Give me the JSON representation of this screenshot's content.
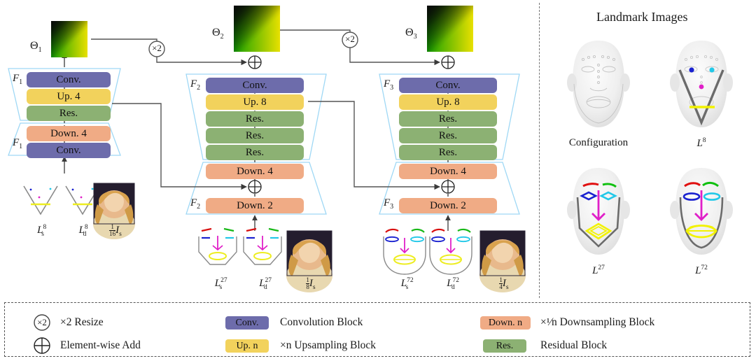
{
  "figure": {
    "panel_title": "Landmark Images"
  },
  "stages": [
    {
      "id": "stage1",
      "theta_label": "Θ1",
      "ftag_top": "F1",
      "ftag_bottom": "F1",
      "blocks_top": [
        "Conv.",
        "Up. 4",
        "Res."
      ],
      "blocks_bottom": [
        "Down. 4",
        "Conv."
      ],
      "inputs": [
        "L8s",
        "L8d",
        "1/16 Is"
      ],
      "input_captions": [
        "L",
        "L",
        "I"
      ],
      "resize_label": "×2"
    },
    {
      "id": "stage2",
      "theta_label": "Θ2",
      "ftag_top": "F2",
      "ftag_bottom": "F2",
      "blocks_top": [
        "Conv.",
        "Up. 8",
        "Res.",
        "Res.",
        "Res."
      ],
      "blocks_bottom": [
        "Down. 4",
        "Down. 2"
      ],
      "inputs": [
        "L27s",
        "L27d",
        "1/8 Is"
      ],
      "resize_label": "×2"
    },
    {
      "id": "stage3",
      "theta_label": "Θ3",
      "ftag_top": "F3",
      "ftag_bottom": "F3",
      "blocks_top": [
        "Conv.",
        "Up. 8",
        "Res.",
        "Res.",
        "Res."
      ],
      "blocks_bottom": [
        "Down. 4",
        "Down. 2"
      ],
      "inputs": [
        "L72s",
        "L72d",
        "1/4 Is"
      ]
    }
  ],
  "stage_labels": {
    "s1": {
      "theta": "Θ",
      "theta_sub": "1",
      "f_top": "F",
      "f_top_sub": "1",
      "f_bot": "F",
      "f_bot_sub": "1",
      "b0": "Conv.",
      "b1": "Up. 4",
      "b2": "Res.",
      "b3": "Down. 4",
      "b4": "Conv.",
      "cap_ls": "L",
      "cap_ls_sup": "8",
      "cap_ls_sub": "s",
      "cap_ld": "L",
      "cap_ld_sup": "8",
      "cap_ld_sub": "d",
      "cap_img_num": "1",
      "cap_img_den": "16",
      "cap_img": "I",
      "cap_img_sub": "s"
    },
    "s2": {
      "theta": "Θ",
      "theta_sub": "2",
      "f_top": "F",
      "f_top_sub": "2",
      "f_bot": "F",
      "f_bot_sub": "2",
      "b0": "Conv.",
      "b1": "Up. 8",
      "b2": "Res.",
      "b3": "Res.",
      "b4": "Res.",
      "b5": "Down. 4",
      "b6": "Down. 2",
      "cap_ls": "L",
      "cap_ls_sup": "27",
      "cap_ls_sub": "s",
      "cap_ld": "L",
      "cap_ld_sup": "27",
      "cap_ld_sub": "d",
      "cap_img_num": "1",
      "cap_img_den": "8",
      "cap_img": "I",
      "cap_img_sub": "s"
    },
    "s3": {
      "theta": "Θ",
      "theta_sub": "3",
      "f_top": "F",
      "f_top_sub": "3",
      "f_bot": "F",
      "f_bot_sub": "3",
      "b0": "Conv.",
      "b1": "Up. 8",
      "b2": "Res.",
      "b3": "Res.",
      "b4": "Res.",
      "b5": "Down. 4",
      "b6": "Down. 2",
      "cap_ls": "L",
      "cap_ls_sup": "72",
      "cap_ls_sub": "s",
      "cap_ld": "L",
      "cap_ld_sup": "72",
      "cap_ld_sub": "d",
      "cap_img_num": "1",
      "cap_img_den": "4",
      "cap_img": "I",
      "cap_img_sub": "s"
    }
  },
  "resize_nodes": {
    "r1": "×2",
    "r2": "×2"
  },
  "landmark_panel": {
    "title": "Landmark Images",
    "items": [
      {
        "label": "Configuration",
        "sup": ""
      },
      {
        "label": "L",
        "sup": "8"
      },
      {
        "label": "L",
        "sup": "27"
      },
      {
        "label": "L",
        "sup": "72"
      }
    ]
  },
  "legend": {
    "rows": [
      {
        "icon": "×2",
        "icon_kind": "circle-x2",
        "text": "×2 Resize"
      },
      {
        "icon": "⊕",
        "icon_kind": "circle-plus",
        "text": "Element-wise Add"
      }
    ],
    "chips": [
      {
        "chip": "Conv.",
        "kind": "conv",
        "text": "Convolution Block"
      },
      {
        "chip": "Up. n",
        "kind": "up",
        "text_pre": "×n Upsampling Block",
        "text": "×n Upsampling Block"
      },
      {
        "chip": "Down. n",
        "kind": "down",
        "text": "×¹⁄n Downsampling Block"
      },
      {
        "chip": "Res.",
        "kind": "res",
        "text": "Residual Block"
      }
    ]
  },
  "colors": {
    "conv": "#6d6cab",
    "up": "#f2d25c",
    "res": "#8cb173",
    "down": "#f0ab85",
    "trapezoid_outline": "#9fd8f5",
    "arrow": "#444444",
    "divider": "#777777"
  }
}
